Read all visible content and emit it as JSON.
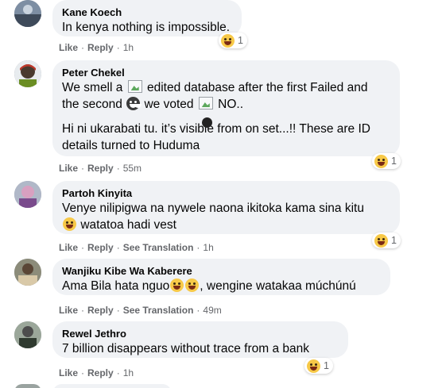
{
  "comments": [
    {
      "author": "Kane Koech",
      "paragraphs": [
        "In kenya nothing is impossible."
      ],
      "reaction_count": "1",
      "actions": {
        "like": "Like",
        "reply": "Reply",
        "time": "1h"
      }
    },
    {
      "author": "Peter Chekel",
      "line1_a": "We smell a",
      "line1_b": "edited database after the first Failed and",
      "line2_a": "the second",
      "line2_b": "we voted",
      "line2_c": "NO..",
      "para2_a": "Hi ni ukarabati tu. it’s visible from on set...!! These are ID",
      "para2_b": "details turned to Huduma",
      "reaction_count": "1",
      "actions": {
        "like": "Like",
        "reply": "Reply",
        "time": "55m"
      }
    },
    {
      "author": "Partoh Kinyita",
      "line1": "Venye nilipigwa na nywele naona ikitoka kama sina kitu",
      "line2": "watatoa hadi vest",
      "reaction_count": "1",
      "actions": {
        "like": "Like",
        "reply": "Reply",
        "translation": "See Translation",
        "time": "1h"
      }
    },
    {
      "author": "Wanjiku Kibe Wa Kaberere",
      "line1_a": "Ama Bila hata nguo",
      "line1_b": ", wengine watakaa múchúnú",
      "actions": {
        "like": "Like",
        "reply": "Reply",
        "translation": "See Translation",
        "time": "49m"
      }
    },
    {
      "author": "Rewel Jethro",
      "paragraphs": [
        "7 billion disappears without trace from a bank"
      ],
      "reaction_count": "1",
      "actions": {
        "like": "Like",
        "reply": "Reply",
        "time": "1h"
      }
    }
  ],
  "colors": {
    "bubble": "#f0f2f5",
    "meta": "#65676b",
    "text": "#050505"
  },
  "icons": {
    "reaction": "laughing-emoji-icon",
    "broken_image": "broken-image-icon"
  }
}
